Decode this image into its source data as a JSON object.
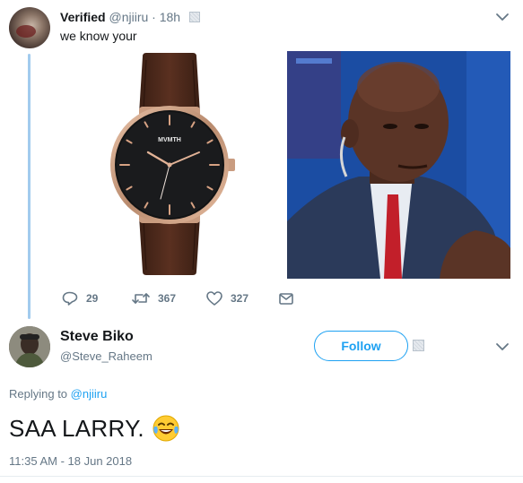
{
  "tweet1": {
    "author_name": "Verified",
    "author_handle": "@njiiru",
    "time": "18h",
    "text": "we know your",
    "watch_brand": "MVMTH",
    "actions": {
      "replies": "29",
      "retweets": "367",
      "likes": "327"
    }
  },
  "tweet2": {
    "author_name": "Steve Biko",
    "author_handle": "@Steve_Raheem",
    "follow_label": "Follow",
    "replying_prefix": "Replying to",
    "replying_handle": "@njiiru",
    "text": "SAA LARRY.",
    "emoji": "crying-laughing-face",
    "timestamp": "11:35 AM - 18 Jun 2018"
  },
  "colors": {
    "accent": "#1da1f2",
    "secondary_text": "#657786",
    "thread_line": "#a2cbee",
    "primary_text": "#14171a"
  }
}
